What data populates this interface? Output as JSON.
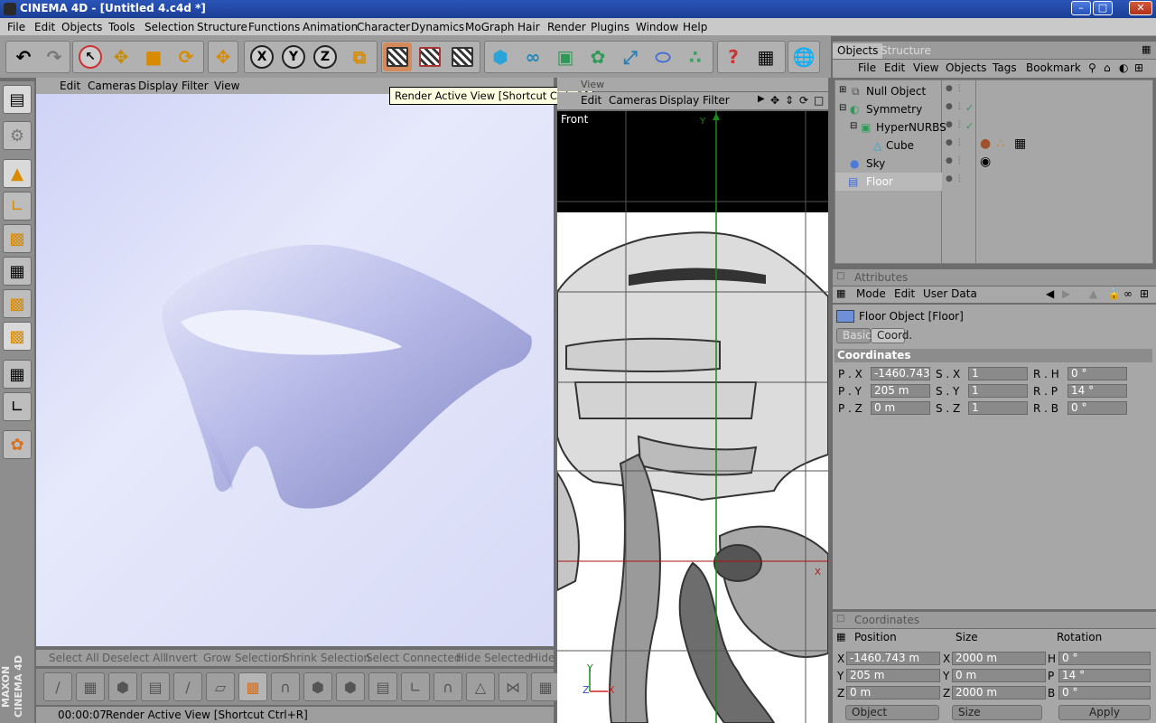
{
  "window": {
    "title": "CINEMA 4D - [Untitled 4.c4d *]"
  },
  "menubar": [
    "File",
    "Edit",
    "Objects",
    "Tools",
    "Selection",
    "Structure",
    "Functions",
    "Animation",
    "Character",
    "Dynamics",
    "MoGraph",
    "Hair",
    "Render",
    "Plugins",
    "Window",
    "Help"
  ],
  "tooltip": "Render Active View [Shortcut Ctrl+R]",
  "viewport_left": {
    "menu": [
      "Edit",
      "Cameras",
      "Display",
      "Filter",
      "View"
    ]
  },
  "viewport_right": {
    "title": "View",
    "menu": [
      "Edit",
      "Cameras",
      "Display",
      "Filter"
    ],
    "label": "Front",
    "axis_y": "Y",
    "axis_z": "Z",
    "axis_x": "X"
  },
  "selection_bar": [
    "Select All",
    "Deselect All",
    "Invert",
    "Grow Selection",
    "Shrink Selection",
    "Select Connected",
    "Hide Selected",
    "Hide"
  ],
  "status": {
    "time": "00:00:07",
    "message": "Render Active View [Shortcut Ctrl+R]"
  },
  "brand": "MAXON CINEMA 4D",
  "object_manager": {
    "tabs": [
      "Objects",
      "Structure"
    ],
    "menu": [
      "File",
      "Edit",
      "View",
      "Objects",
      "Tags",
      "Bookmark"
    ],
    "items": [
      {
        "name": "Null Object"
      },
      {
        "name": "Symmetry"
      },
      {
        "name": "HyperNURBS"
      },
      {
        "name": "Cube"
      },
      {
        "name": "Sky"
      },
      {
        "name": "Floor"
      }
    ]
  },
  "attributes": {
    "title": "Attributes",
    "menu": [
      "Mode",
      "Edit",
      "User Data"
    ],
    "object_label": "Floor Object [Floor]",
    "tabs": [
      "Basic",
      "Coord."
    ],
    "section": "Coordinates",
    "rows": [
      {
        "a_label": "P . X",
        "a_val": "-1460.743",
        "b_label": "S . X",
        "b_val": "1",
        "c_label": "R . H",
        "c_val": "0 °"
      },
      {
        "a_label": "P . Y",
        "a_val": "205 m",
        "b_label": "S . Y",
        "b_val": "1",
        "c_label": "R . P",
        "c_val": "14 °"
      },
      {
        "a_label": "P . Z",
        "a_val": "0 m",
        "b_label": "S . Z",
        "b_val": "1",
        "c_label": "R . B",
        "c_val": "0 °"
      }
    ]
  },
  "coordinates": {
    "title": "Coordinates",
    "headers": [
      "Position",
      "Size",
      "Rotation"
    ],
    "rows": [
      {
        "p": "X",
        "pv": "-1460.743 m",
        "s": "X",
        "sv": "2000 m",
        "r": "H",
        "rv": "0 °"
      },
      {
        "p": "Y",
        "pv": "205 m",
        "s": "Y",
        "sv": "0 m",
        "r": "P",
        "rv": "14 °"
      },
      {
        "p": "Z",
        "pv": "0 m",
        "s": "Z",
        "sv": "2000 m",
        "r": "B",
        "rv": "0 °"
      }
    ],
    "mode_select": "Object",
    "size_select": "Size",
    "apply": "Apply"
  },
  "colors": {
    "titlebar": "#1f49a8",
    "panel": "#a7a7a7",
    "viewport": "#d8dbf7",
    "shape": "#a9acde"
  }
}
